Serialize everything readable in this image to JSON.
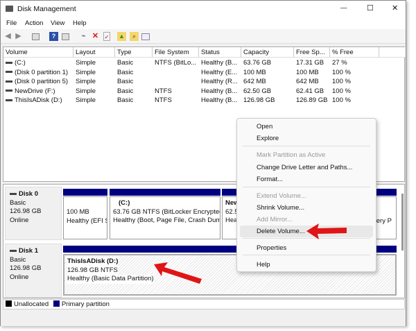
{
  "window": {
    "title": "Disk Management",
    "minimize": "—",
    "maximize": "☐",
    "close": "✕"
  },
  "menu": [
    "File",
    "Action",
    "View",
    "Help"
  ],
  "toolbar": {
    "icons": [
      "back-icon",
      "forward-icon",
      "console-tree-icon",
      "help-icon",
      "details-pane-icon",
      "connect-icon",
      "delete-icon",
      "properties-icon",
      "folder-up-icon",
      "search-folder-icon",
      "list-icon"
    ],
    "delete_color": "#e01010"
  },
  "columns": [
    "Volume",
    "Layout",
    "Type",
    "File System",
    "Status",
    "Capacity",
    "Free Sp...",
    "% Free"
  ],
  "volumes": [
    [
      "(C:)",
      "Simple",
      "Basic",
      "NTFS (BitLo...",
      "Healthy (B...",
      "63.76 GB",
      "17.31 GB",
      "27 %"
    ],
    [
      "(Disk 0 partition 1)",
      "Simple",
      "Basic",
      "",
      "Healthy (E...",
      "100 MB",
      "100 MB",
      "100 %"
    ],
    [
      "(Disk 0 partition 5)",
      "Simple",
      "Basic",
      "",
      "Healthy (R...",
      "642 MB",
      "642 MB",
      "100 %"
    ],
    [
      "NewDrive (F:)",
      "Simple",
      "Basic",
      "NTFS",
      "Healthy (B...",
      "62.50 GB",
      "62.41 GB",
      "100 %"
    ],
    [
      "ThisIsADisk (D:)",
      "Simple",
      "Basic",
      "NTFS",
      "Healthy (B...",
      "126.98 GB",
      "126.89 GB",
      "100 %"
    ]
  ],
  "disks": [
    {
      "name": "Disk 0",
      "type": "Basic",
      "size": "126.98 GB",
      "state": "Online",
      "partitions": [
        {
          "title": "",
          "line1": "100 MB",
          "line2": "Healthy (EFI S"
        },
        {
          "title": "(C:)",
          "line1": "63.76 GB NTFS (BitLocker Encrypted",
          "line2": "Healthy (Boot, Page File, Crash Dum"
        },
        {
          "title": "New",
          "line1": "62.5",
          "line2": "Hea"
        },
        {
          "title": "",
          "line1": "",
          "line2": "very P"
        }
      ]
    },
    {
      "name": "Disk 1",
      "type": "Basic",
      "size": "126.98 GB",
      "state": "Online",
      "partitions": [
        {
          "title": "ThisIsADisk  (D:)",
          "line1": "126.98 GB NTFS",
          "line2": "Healthy (Basic Data Partition)"
        }
      ]
    }
  ],
  "legend": {
    "unallocated": "Unallocated",
    "primary": "Primary partition",
    "unallocated_color": "#000000",
    "primary_color": "#000080"
  },
  "context_menu": [
    {
      "label": "Open",
      "enabled": true
    },
    {
      "label": "Explore",
      "enabled": true
    },
    {
      "label": "Mark Partition as Active",
      "enabled": false
    },
    {
      "label": "Change Drive Letter and Paths...",
      "enabled": true
    },
    {
      "label": "Format...",
      "enabled": true
    },
    {
      "label": "Extend Volume...",
      "enabled": false
    },
    {
      "label": "Shrink Volume...",
      "enabled": true
    },
    {
      "label": "Add Mirror...",
      "enabled": false
    },
    {
      "label": "Delete Volume...",
      "enabled": true,
      "highlighted": true
    },
    {
      "label": "Properties",
      "enabled": true
    },
    {
      "label": "Help",
      "enabled": true
    }
  ],
  "annotation_color": "#e01515"
}
